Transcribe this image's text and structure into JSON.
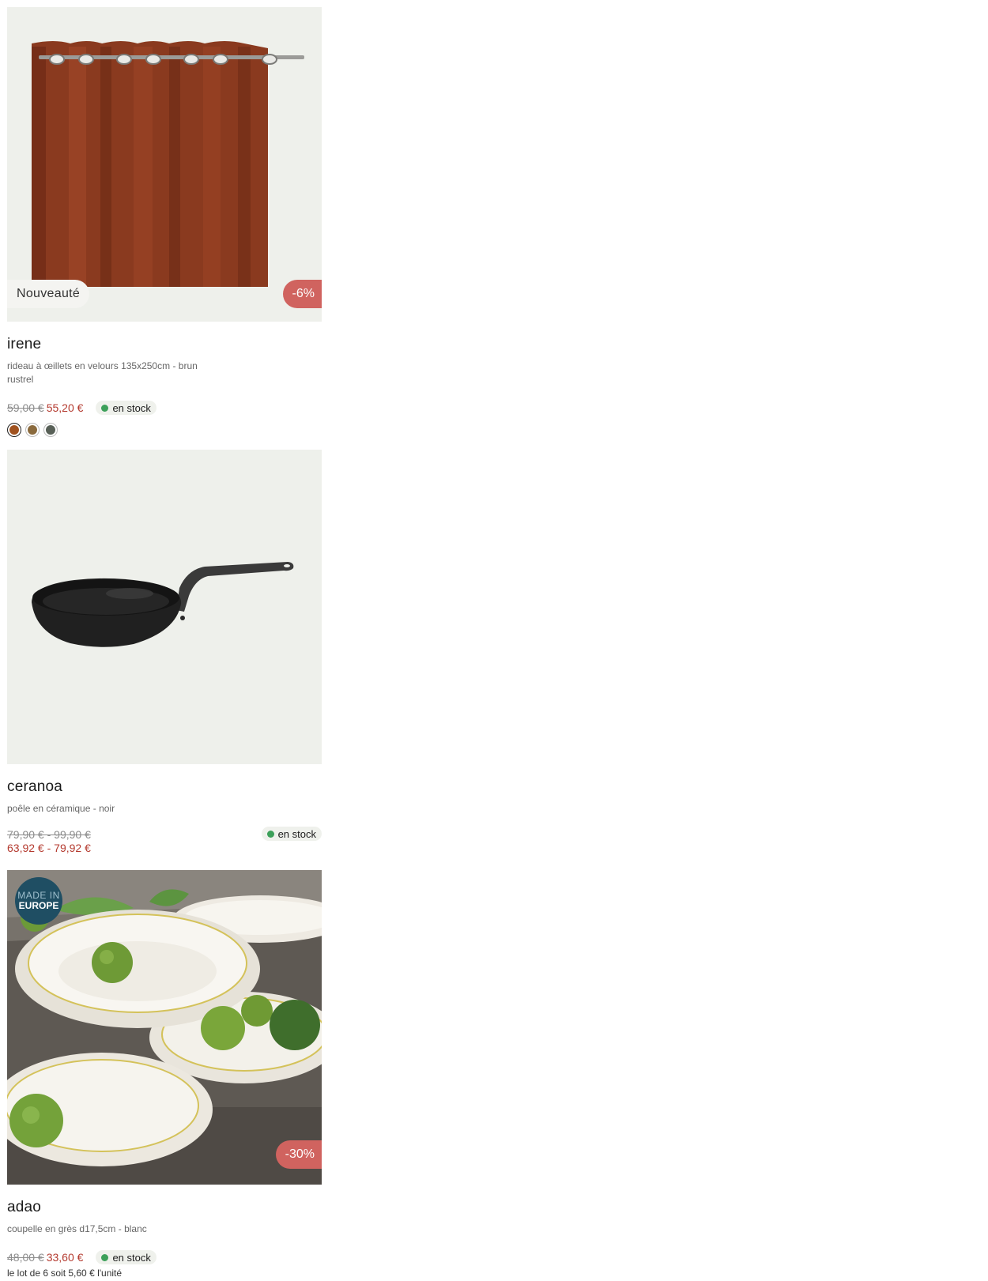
{
  "products": [
    {
      "name": "irene",
      "description": "rideau à œillets en velours 135x250cm - brun rustrel",
      "badge_new": "Nouveauté",
      "discount": "-6%",
      "old_price": "59,00 €",
      "price": "55,20 €",
      "stock": "en stock",
      "swatches": [
        "#a0521f",
        "#8a6a3d",
        "#586057"
      ]
    },
    {
      "name": "ceranoa",
      "description": "poêle en céramique - noir",
      "old_price": "79,90 € - 99,90 €",
      "price": "63,92 € - 79,92 €",
      "stock": "en stock"
    },
    {
      "name": "adao",
      "description": "coupelle en grès d17,5cm - blanc",
      "made_in_line1": "MADE IN",
      "made_in_line2": "EUROPE",
      "discount": "-30%",
      "old_price": "48,00 €",
      "price": "33,60 €",
      "stock": "en stock",
      "lot_text": "le lot de 6 soit 5,60 € l'unité"
    }
  ],
  "colors": {
    "accent_price": "#b43a2f",
    "discount_badge": "#d0635f",
    "stock_dot": "#3ca05a",
    "made_in_badge": "#1f4e63"
  }
}
